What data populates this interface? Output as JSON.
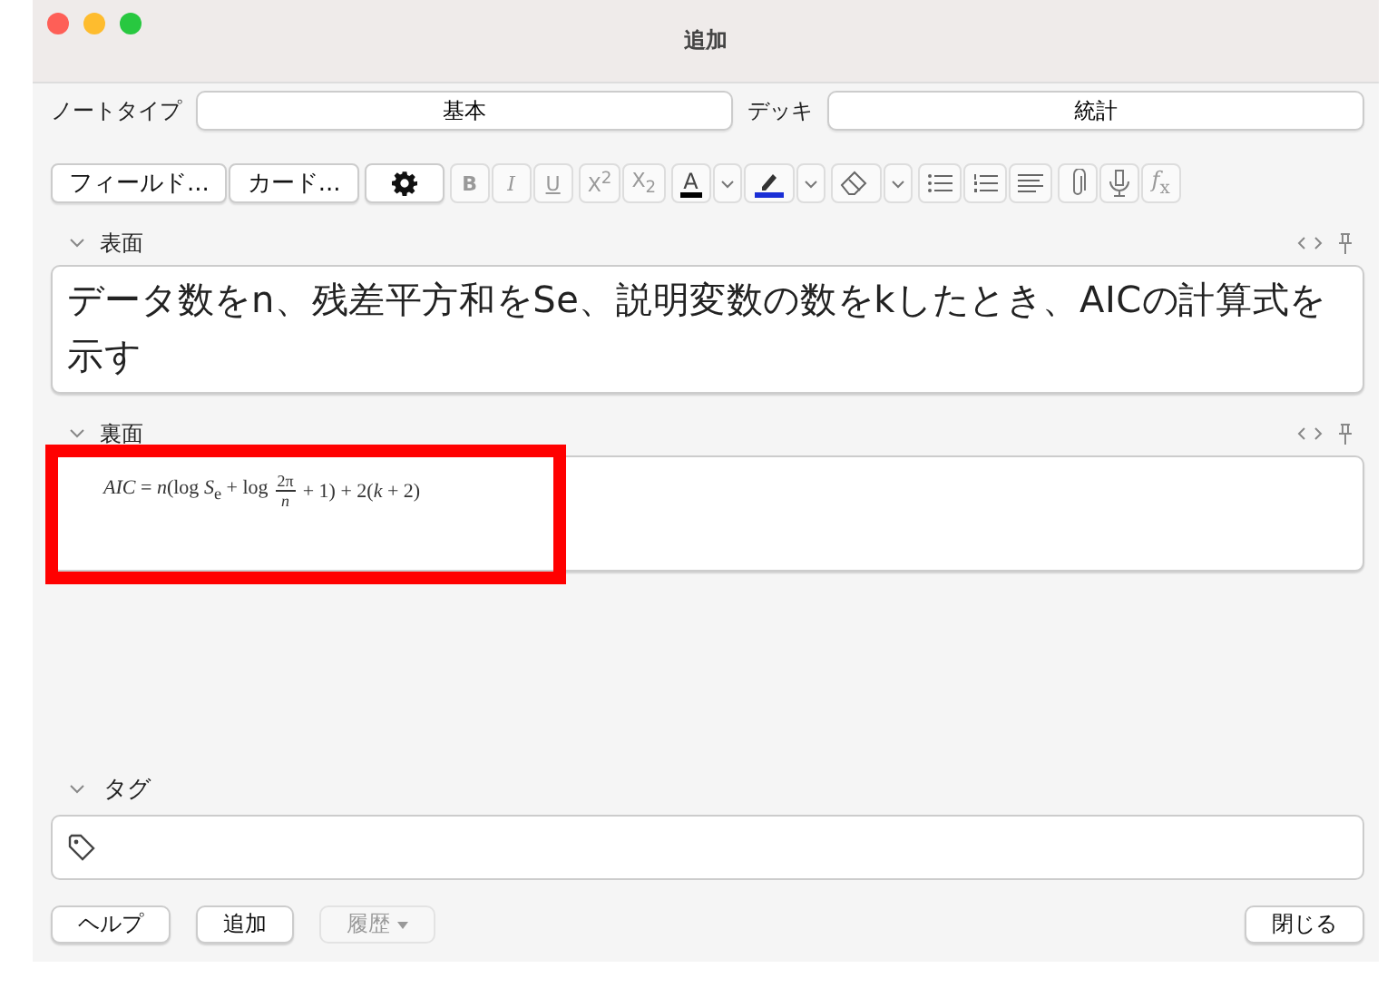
{
  "window": {
    "title": "追加"
  },
  "note_type": {
    "label": "ノートタイプ",
    "value": "基本"
  },
  "deck": {
    "label": "デッキ",
    "value": "統計"
  },
  "toolbar": {
    "field_buttons": [
      "フィールド...",
      "カード..."
    ],
    "format_buttons": [
      "B",
      "I",
      "U"
    ],
    "script_buttons": [
      "X$^{2}$",
      "X$_{2}$"
    ],
    "text_color": {
      "label": "A",
      "color": "#000000"
    },
    "highlight_color": {
      "color": "#1a2fd6"
    },
    "function_button": "*f*$_{x}$"
  },
  "fields": [
    {
      "name": "表面",
      "expanded": true,
      "kind": "text",
      "text": "データ数をn、残差平方和をSe、説明変数の数をkしたとき、AICの計算式を示す"
    },
    {
      "name": "裏面",
      "expanded": true,
      "kind": "formula",
      "highlighted": true,
      "formula": {
        "before": "*AIC* = *n*(log *S*$_{e}$ + log",
        "numerator": "2π",
        "denominator": "*n*",
        "after": "+ 1) + 2(*k* + 2)"
      }
    }
  ],
  "tags": {
    "label": "タグ",
    "expanded": true
  },
  "buttons": {
    "help": "ヘルプ",
    "add": "追加",
    "history": {
      "label": "履歴",
      "disabled": true
    },
    "close": "閉じる"
  }
}
